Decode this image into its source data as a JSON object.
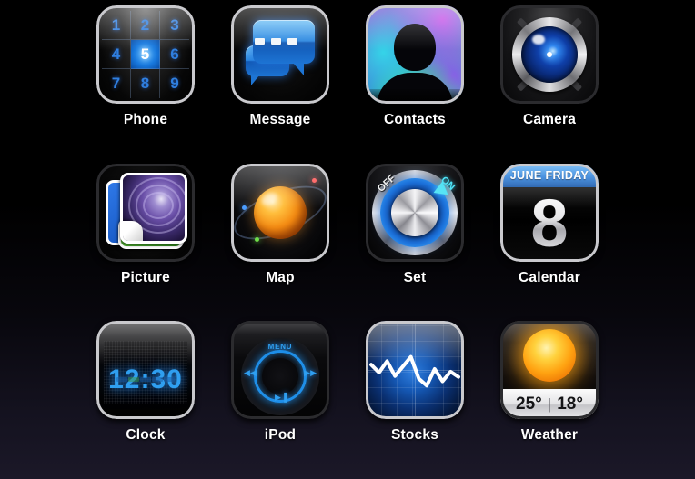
{
  "screen": {
    "background_top": "#000000",
    "background_bottom": "#1b1828",
    "columns": 4,
    "rows": 3
  },
  "apps": [
    {
      "id": "phone",
      "label": "Phone",
      "icon_name": "phone-keypad-icon",
      "keypad": [
        "1",
        "2",
        "3",
        "4",
        "5",
        "6",
        "7",
        "8",
        "9"
      ],
      "highlighted_key": "5",
      "key_color": "#2f7fe0",
      "highlight_color": "#1878dd"
    },
    {
      "id": "message",
      "label": "Message",
      "icon_name": "message-bubbles-icon",
      "bubble_color": "#2a86e0",
      "dot_count": 3
    },
    {
      "id": "contacts",
      "label": "Contacts",
      "icon_name": "contacts-silhouette-icon",
      "aurora_colors": [
        "#c552e8",
        "#35d4e8",
        "#4fe08a",
        "#8a5ce8"
      ],
      "silhouette_color": "#050509"
    },
    {
      "id": "camera",
      "label": "Camera",
      "icon_name": "camera-lens-icon",
      "lens_color": "#0f3fa8",
      "ring_color": "#e8e8ea"
    },
    {
      "id": "picture",
      "label": "Picture",
      "icon_name": "picture-photostack-icon",
      "card_colors": [
        "#2f79e8",
        "#5fc63a"
      ],
      "photo_subject": "galaxy-spiral"
    },
    {
      "id": "map",
      "label": "Map",
      "icon_name": "map-planet-icon",
      "planet_color": "#f58b12",
      "marker_colors": [
        "#6fe04a",
        "#4a9cff",
        "#ff4a4a"
      ]
    },
    {
      "id": "set",
      "label": "Set",
      "icon_name": "settings-dial-icon",
      "off_label": "OFF",
      "on_label": "ON",
      "on_color": "#4fe3f6",
      "glow_color": "#1b6fd8"
    },
    {
      "id": "calendar",
      "label": "Calendar",
      "icon_name": "calendar-date-icon",
      "header_text": "JUNE FRIDAY",
      "day_number": "8",
      "header_color": "#1874d8"
    },
    {
      "id": "clock",
      "label": "Clock",
      "icon_name": "clock-digital-icon",
      "time": "12:30",
      "digit_color": "#2f9ff0"
    },
    {
      "id": "ipod",
      "label": "iPod",
      "icon_name": "ipod-clickwheel-icon",
      "menu_label": "MENU",
      "prev_glyph": "◀◀",
      "next_glyph": "▶▶",
      "play_glyph": "▶▐",
      "wheel_glow_color": "#1f8fe8"
    },
    {
      "id": "stocks",
      "label": "Stocks",
      "icon_name": "stocks-chart-icon",
      "line_color": "#ffffff",
      "background_color": "#1558b4"
    },
    {
      "id": "weather",
      "label": "Weather",
      "icon_name": "weather-sun-icon",
      "high_temp": "25°",
      "separator": "|",
      "low_temp": "18°",
      "sun_color": "#ffa211"
    }
  ],
  "chart_data": {
    "type": "line",
    "title": "Stocks",
    "x": [
      0,
      1,
      2,
      3,
      4,
      5,
      6,
      7,
      8,
      9,
      10,
      11
    ],
    "values": [
      62,
      44,
      70,
      36,
      58,
      80,
      30,
      14,
      52,
      24,
      46,
      34
    ],
    "xlabel": "",
    "ylabel": "",
    "ylim": [
      0,
      100
    ],
    "grid": true,
    "legend": "none"
  }
}
